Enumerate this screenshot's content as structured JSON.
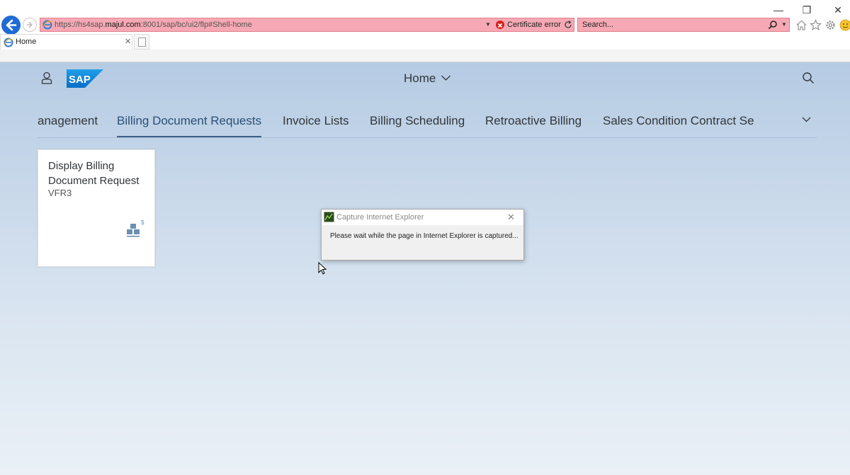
{
  "browser": {
    "url_prefix": "https://hs4sap.",
    "url_domain": "majul.com",
    "url_suffix": ":8001/sap/bc/ui2/flp#Shell-home",
    "certificate_label": "Certificate error",
    "search_placeholder": "Search...",
    "tabs": [
      {
        "label": "Home"
      }
    ],
    "accent_color": "#1e6bd6",
    "warning_bar_color": "#f6a9b4"
  },
  "shell": {
    "title": "Home",
    "brand": "SAP",
    "brand_color": "#1e8fd6"
  },
  "nav": {
    "tabs": [
      {
        "label": "anagement"
      },
      {
        "label": "Billing Document Requests",
        "selected": true
      },
      {
        "label": "Invoice Lists"
      },
      {
        "label": "Billing Scheduling"
      },
      {
        "label": "Retroactive Billing"
      },
      {
        "label": "Sales Condition Contract Se"
      }
    ]
  },
  "tile": {
    "title": "Display Billing Document Request",
    "subtitle": "VFR3",
    "icon": "billing-document-icon"
  },
  "dialog": {
    "title": "Capture Internet Explorer",
    "message": "Please wait while the page in Internet Explorer is captured..."
  }
}
